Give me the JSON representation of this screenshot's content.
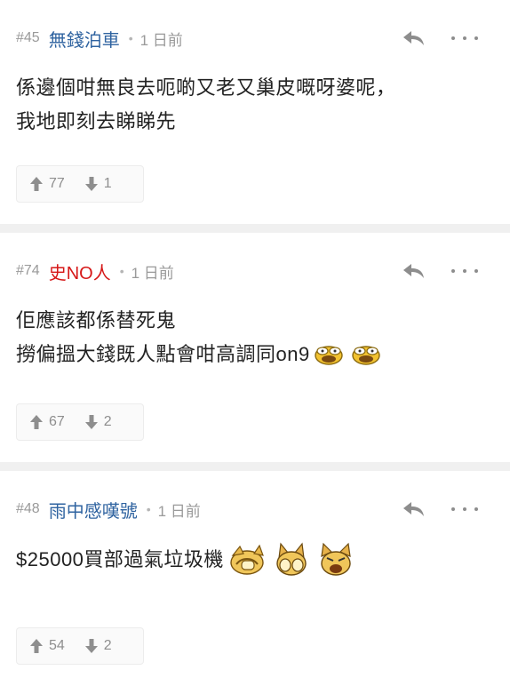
{
  "comments": [
    {
      "floor": "#45",
      "username": "無錢泊車",
      "time": "1 日前",
      "lines": [
        "係邊個咁無良去呃啲又老又巢皮嘅呀婆呢，",
        "我地即刻去睇睇先"
      ],
      "upvotes": "77",
      "downvotes": "1"
    },
    {
      "floor": "#74",
      "username": "史NO人",
      "time": "1 日前",
      "lines": [
        "佢應該都係替死鬼",
        "撈偏搵大錢既人點會咁高調同on9"
      ],
      "emoticons": [
        "shocked-face-icon",
        "shocked-face-icon"
      ],
      "upvotes": "67",
      "downvotes": "2"
    },
    {
      "floor": "#48",
      "username": "雨中感嘆號",
      "time": "1 日前",
      "lines": [
        "$25000買部過氣垃圾機"
      ],
      "emoticons": [
        "facepalm-emoticon-icon",
        "cover-face-emoticon-icon",
        "angry-dog-emoticon-icon"
      ],
      "upvotes": "54",
      "downvotes": "2"
    }
  ],
  "colors": {
    "username_blue": "#2f63a0",
    "username_red": "#d61818",
    "meta_gray": "#9a9a9a",
    "separator_bg": "#f0f0f0"
  }
}
